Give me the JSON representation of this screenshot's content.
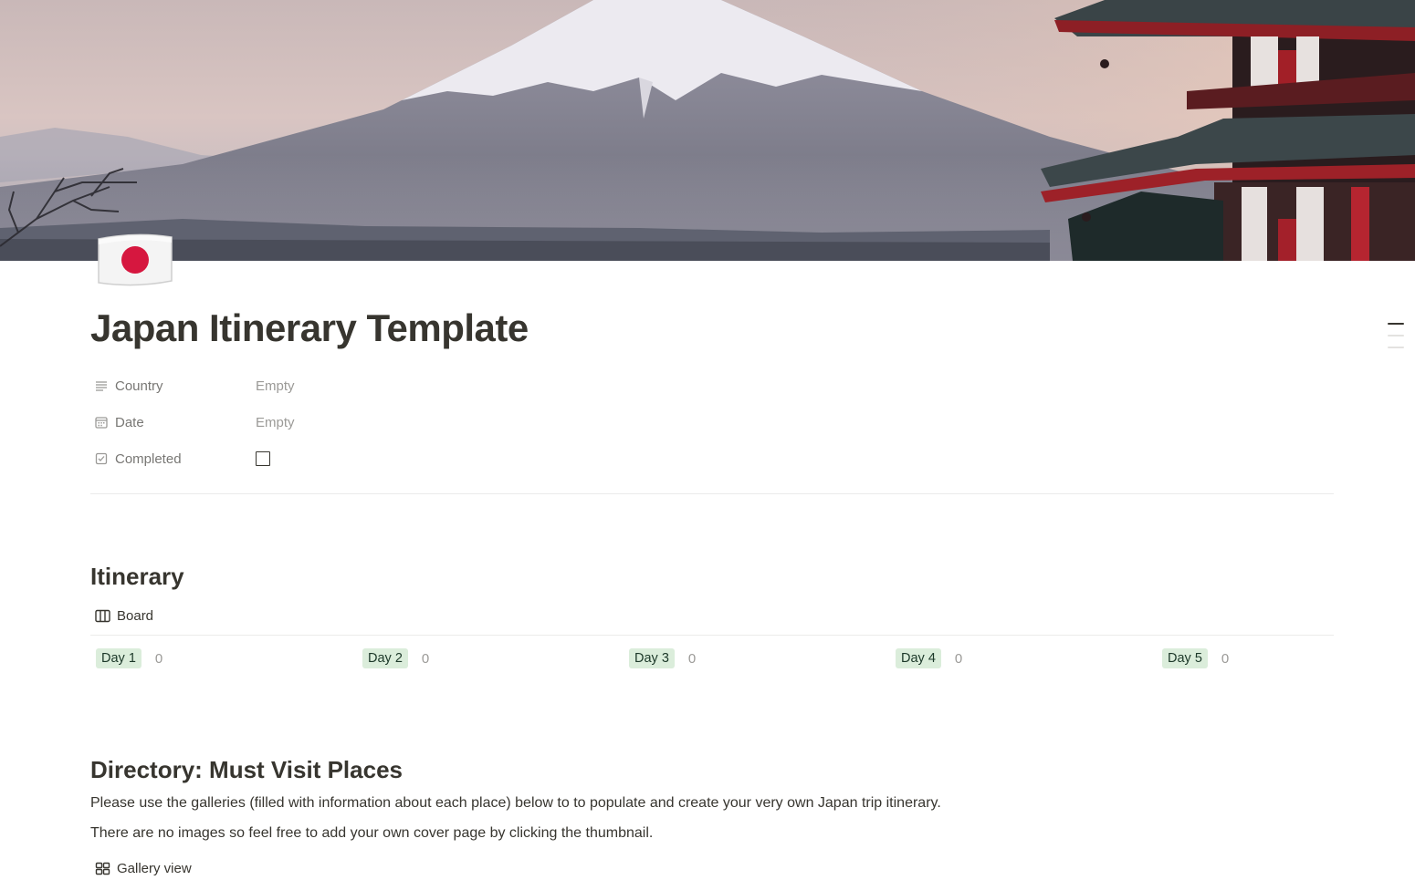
{
  "page": {
    "icon": "japan-flag-icon",
    "title": "Japan Itinerary Template"
  },
  "properties": [
    {
      "icon": "text-lines-icon",
      "name": "Country",
      "value": "Empty"
    },
    {
      "icon": "calendar-icon",
      "name": "Date",
      "value": "Empty"
    },
    {
      "icon": "checkbox-property-icon",
      "name": "Completed",
      "checked": false
    }
  ],
  "itinerary": {
    "heading": "Itinerary",
    "view": {
      "icon": "board-icon",
      "label": "Board"
    },
    "groups": [
      {
        "label": "Day 1",
        "count": "0"
      },
      {
        "label": "Day 2",
        "count": "0"
      },
      {
        "label": "Day 3",
        "count": "0"
      },
      {
        "label": "Day 4",
        "count": "0"
      },
      {
        "label": "Day 5",
        "count": "0"
      }
    ]
  },
  "directory": {
    "heading": "Directory: Must Visit Places",
    "paragraphs": [
      "Please use the galleries (filled with information about each place) below to to populate and create your very own Japan trip itinerary.",
      "There are no images so feel free to add your own cover page by clicking the thumbnail."
    ],
    "view": {
      "icon": "gallery-icon",
      "label": "Gallery view"
    }
  },
  "colors": {
    "text": "#37352f",
    "muted": "#787774",
    "placeholder": "#9b9a97",
    "tag_bg": "#dbeddb",
    "tag_text": "#1c3829",
    "divider": "#ebebea"
  }
}
